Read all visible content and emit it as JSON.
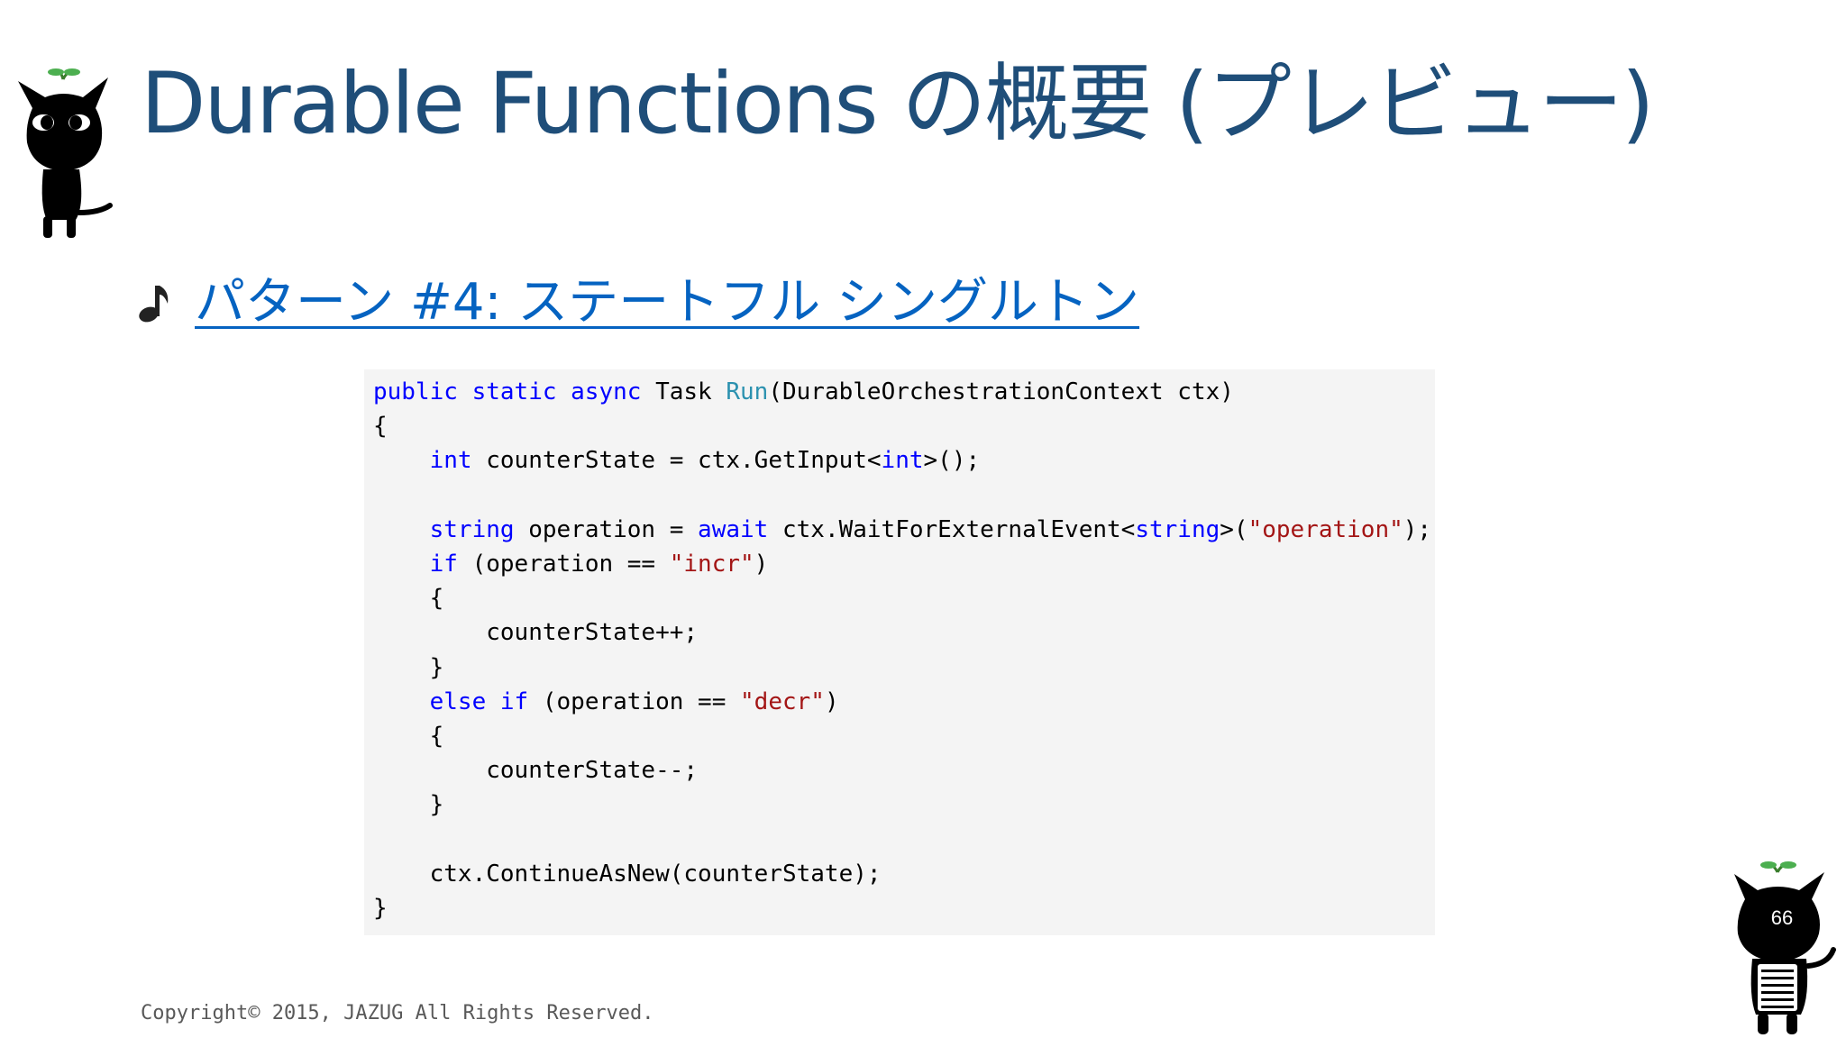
{
  "slide": {
    "title": "Durable Functions の概要 (プレビュー)",
    "bullet": "パターン #4: ステートフル シングルトン",
    "page_number": "66",
    "copyright": "Copyright© 2015, JAZUG All Rights Reserved."
  },
  "code": {
    "line1": {
      "kw1": "public",
      "kw2": "static",
      "kw3": "async",
      "type_task": "Task",
      "method_run": "Run",
      "rest": "(DurableOrchestrationContext ctx)"
    },
    "line2": {
      "brace_open": "{"
    },
    "line3": {
      "kw_int": "int",
      "mid": " counterState = ctx.GetInput<",
      "kw_int2": "int",
      "end": ">();"
    },
    "line5": {
      "kw_string": "string",
      "mid": " operation = ",
      "kw_await": "await",
      "mid2": " ctx.WaitForExternalEvent<",
      "kw_string2": "string",
      "mid3": ">(",
      "str_operation": "\"operation\"",
      "end": ");"
    },
    "line6": {
      "kw_if": "if",
      "mid": " (operation == ",
      "str_incr": "\"incr\"",
      "end": ")"
    },
    "line7": {
      "brace_open": "{"
    },
    "line8": {
      "text": "counterState++;"
    },
    "line9": {
      "brace_close": "}"
    },
    "line10": {
      "kw_else": "else",
      "kw_if": "if",
      "mid": " (operation == ",
      "str_decr": "\"decr\"",
      "end": ")"
    },
    "line11": {
      "brace_open": "{"
    },
    "line12": {
      "text": "counterState--;"
    },
    "line13": {
      "brace_close": "}"
    },
    "line15": {
      "text": "ctx.ContinueAsNew(counterState);"
    },
    "line16": {
      "brace_close": "}"
    }
  },
  "colors": {
    "title": "#1f4e79",
    "link": "#0563c1",
    "keyword": "#0000ff",
    "type": "#2b91af",
    "string": "#a31515",
    "code_background": "#f4f4f4"
  },
  "icons": {
    "top_mascot": "black-cat-mascot-icon",
    "bottom_mascot": "black-cat-mascot-icon",
    "bullet": "music-note-icon"
  }
}
